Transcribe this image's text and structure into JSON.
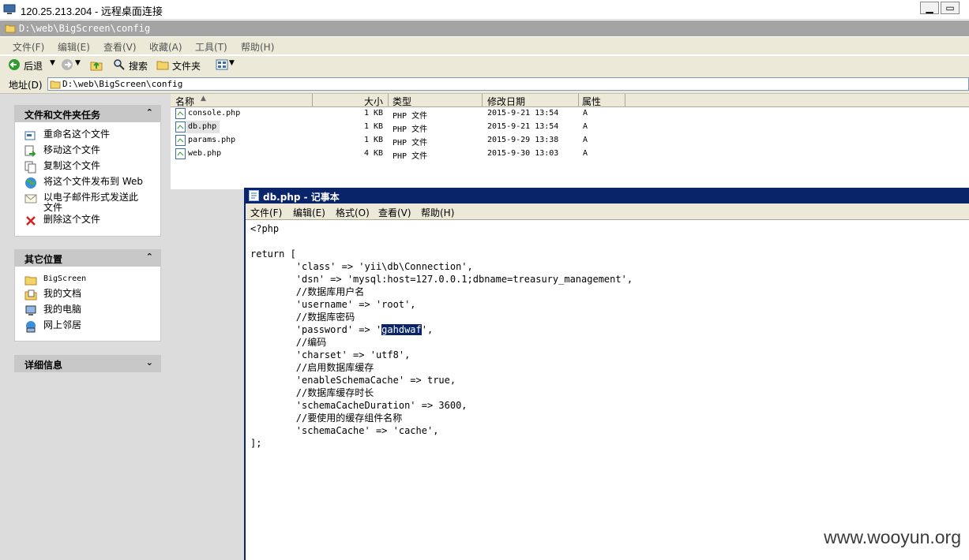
{
  "rdp": {
    "title": "120.25.213.204 - 远程桌面连接"
  },
  "explorer": {
    "title": "D:\\web\\BigScreen\\config",
    "menu": [
      "文件(F)",
      "编辑(E)",
      "查看(V)",
      "收藏(A)",
      "工具(T)",
      "帮助(H)"
    ],
    "toolbar": {
      "back": "后退",
      "search": "搜索",
      "folders": "文件夹"
    },
    "address": {
      "label": "地址(D)",
      "value": "D:\\web\\BigScreen\\config"
    },
    "task_pane": {
      "file_tasks": {
        "title": "文件和文件夹任务",
        "items": [
          "重命名这个文件",
          "移动这个文件",
          "复制这个文件",
          "将这个文件发布到 Web",
          "以电子邮件形式发送此文件",
          "删除这个文件"
        ]
      },
      "other_places": {
        "title": "其它位置",
        "items": [
          "BigScreen",
          "我的文档",
          "我的电脑",
          "网上邻居"
        ]
      },
      "details": {
        "title": "详细信息"
      }
    },
    "columns": {
      "name": "名称",
      "size": "大小",
      "type": "类型",
      "modified": "修改日期",
      "attr": "属性"
    },
    "files": [
      {
        "name": "console.php",
        "size": "1 KB",
        "type": "PHP 文件",
        "modified": "2015-9-21 13:54",
        "attr": "A"
      },
      {
        "name": "db.php",
        "size": "1 KB",
        "type": "PHP 文件",
        "modified": "2015-9-21 13:54",
        "attr": "A"
      },
      {
        "name": "params.php",
        "size": "1 KB",
        "type": "PHP 文件",
        "modified": "2015-9-29 13:38",
        "attr": "A"
      },
      {
        "name": "web.php",
        "size": "4 KB",
        "type": "PHP 文件",
        "modified": "2015-9-30 13:03",
        "attr": "A"
      }
    ]
  },
  "notepad": {
    "title": "db.php - 记事本",
    "menu": [
      "文件(F)",
      "编辑(E)",
      "格式(O)",
      "查看(V)",
      "帮助(H)"
    ],
    "lines": [
      "<?php",
      "",
      "return [",
      "        'class' => 'yii\\db\\Connection',",
      "        'dsn' => 'mysql:host=127.0.0.1;dbname=treasury_management',",
      "        //数据库用户名",
      "        'username' => 'root',",
      "        //数据库密码",
      "        'password' => 'gahdwaf',",
      "        //编码",
      "        'charset' => 'utf8',",
      "        //启用数据库缓存",
      "        'enableSchemaCache' => true,",
      "        //数据库缓存时长",
      "        'schemaCacheDuration' => 3600,",
      "        //要使用的缓存组件名称",
      "        'schemaCache' => 'cache',",
      "];"
    ],
    "password_prefix": "        'password' => '",
    "password_value": "gahdwaf",
    "password_suffix": "',"
  },
  "watermark": "www.wooyun.org"
}
